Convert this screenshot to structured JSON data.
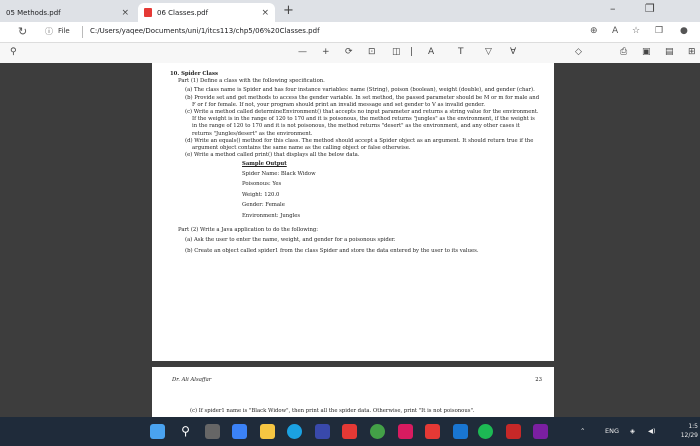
{
  "tabs": [
    {
      "label": "05 Methods.pdf"
    },
    {
      "label": "06 Classes.pdf"
    }
  ],
  "tab_close": "×",
  "new_tab": "+",
  "window_controls": {
    "minimize": "–",
    "restore": "❐"
  },
  "address": {
    "site_label": "File",
    "url": "C:/Users/yaqee/Documents/uni/1/itcs113/chp5/06%20Classes.pdf"
  },
  "toolbar": {
    "zoom_out": "—",
    "zoom_in": "+",
    "page_indicator": "|"
  },
  "document": {
    "heading_num": "10.",
    "heading": "Spider Class",
    "part1": "Part (1) Define a class with the following specification.",
    "a": "(a) The class name is Spider and has four instance variables: name (String), poison (boolean), weight (double), and gender (char).",
    "b": "(b) Provide set and get methods to access the gender variable. In set method, the passed parameter should be M or m for male and F or f for female. If not, your program should print an invalid message and set gender to V as invalid gender.",
    "c": "(c) Write a method called determineEnvironment() that accepts no input parameter and returns a string value for the environment. If the weight is in the range of 120 to 170 and it is poisonous, the method returns \"jungles\" as the environment, if the weight is in the range of 120 to 170 and it is not poisonous, the method returns \"desert\" as the environment, and any other cases it returns \"Jungles/desert\" as the environment.",
    "d": "(d) Write an equals() method for this class. The method should accept a Spider object as an argument. It should return true if the argument object contains the same name as the calling object or false otherwise.",
    "e": "(e) Write a method called print() that displays all the below data.",
    "sample_title": "Sample Output",
    "sample": [
      "Spider Name:   Black Widow",
      "Poisonous:   Yes",
      "Weight:   120.0",
      "Gender:   Female",
      "Environment:   Jungles"
    ],
    "part2": "Part (2) Write a Java application to do the following:",
    "p2a": "(a) Ask the user to enter the name, weight, and gender for a poisonous spider.",
    "p2b": "(b) Create an object called spider1 from the class Spider and store the data entered by the user to its values.",
    "footer_author": "Dr. Ali Alsaffar",
    "footer_page": "23",
    "p2c": "(c) If spider1 name is \"Black Widow\", then print all the spider data. Otherwise, print \"It is not poisonous\"."
  },
  "taskbar": {
    "lang": "ENG",
    "time": "1:5",
    "date": "12/29"
  },
  "colors": {
    "pdf_icon": "#e53935",
    "taskbar": "#1f2b3a"
  }
}
